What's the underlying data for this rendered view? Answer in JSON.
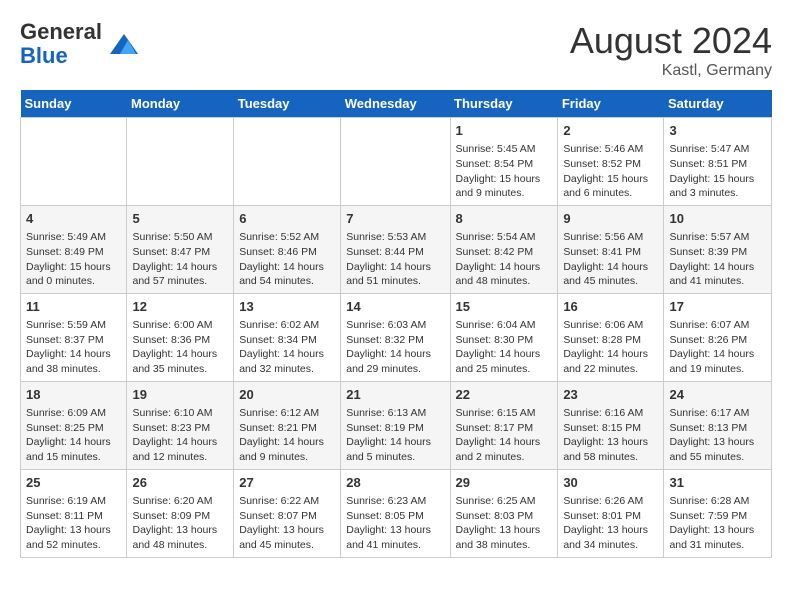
{
  "header": {
    "logo_general": "General",
    "logo_blue": "Blue",
    "month_year": "August 2024",
    "location": "Kastl, Germany"
  },
  "days_of_week": [
    "Sunday",
    "Monday",
    "Tuesday",
    "Wednesday",
    "Thursday",
    "Friday",
    "Saturday"
  ],
  "weeks": [
    [
      {
        "day": "",
        "info": ""
      },
      {
        "day": "",
        "info": ""
      },
      {
        "day": "",
        "info": ""
      },
      {
        "day": "",
        "info": ""
      },
      {
        "day": "1",
        "info": "Sunrise: 5:45 AM\nSunset: 8:54 PM\nDaylight: 15 hours\nand 9 minutes."
      },
      {
        "day": "2",
        "info": "Sunrise: 5:46 AM\nSunset: 8:52 PM\nDaylight: 15 hours\nand 6 minutes."
      },
      {
        "day": "3",
        "info": "Sunrise: 5:47 AM\nSunset: 8:51 PM\nDaylight: 15 hours\nand 3 minutes."
      }
    ],
    [
      {
        "day": "4",
        "info": "Sunrise: 5:49 AM\nSunset: 8:49 PM\nDaylight: 15 hours\nand 0 minutes."
      },
      {
        "day": "5",
        "info": "Sunrise: 5:50 AM\nSunset: 8:47 PM\nDaylight: 14 hours\nand 57 minutes."
      },
      {
        "day": "6",
        "info": "Sunrise: 5:52 AM\nSunset: 8:46 PM\nDaylight: 14 hours\nand 54 minutes."
      },
      {
        "day": "7",
        "info": "Sunrise: 5:53 AM\nSunset: 8:44 PM\nDaylight: 14 hours\nand 51 minutes."
      },
      {
        "day": "8",
        "info": "Sunrise: 5:54 AM\nSunset: 8:42 PM\nDaylight: 14 hours\nand 48 minutes."
      },
      {
        "day": "9",
        "info": "Sunrise: 5:56 AM\nSunset: 8:41 PM\nDaylight: 14 hours\nand 45 minutes."
      },
      {
        "day": "10",
        "info": "Sunrise: 5:57 AM\nSunset: 8:39 PM\nDaylight: 14 hours\nand 41 minutes."
      }
    ],
    [
      {
        "day": "11",
        "info": "Sunrise: 5:59 AM\nSunset: 8:37 PM\nDaylight: 14 hours\nand 38 minutes."
      },
      {
        "day": "12",
        "info": "Sunrise: 6:00 AM\nSunset: 8:36 PM\nDaylight: 14 hours\nand 35 minutes."
      },
      {
        "day": "13",
        "info": "Sunrise: 6:02 AM\nSunset: 8:34 PM\nDaylight: 14 hours\nand 32 minutes."
      },
      {
        "day": "14",
        "info": "Sunrise: 6:03 AM\nSunset: 8:32 PM\nDaylight: 14 hours\nand 29 minutes."
      },
      {
        "day": "15",
        "info": "Sunrise: 6:04 AM\nSunset: 8:30 PM\nDaylight: 14 hours\nand 25 minutes."
      },
      {
        "day": "16",
        "info": "Sunrise: 6:06 AM\nSunset: 8:28 PM\nDaylight: 14 hours\nand 22 minutes."
      },
      {
        "day": "17",
        "info": "Sunrise: 6:07 AM\nSunset: 8:26 PM\nDaylight: 14 hours\nand 19 minutes."
      }
    ],
    [
      {
        "day": "18",
        "info": "Sunrise: 6:09 AM\nSunset: 8:25 PM\nDaylight: 14 hours\nand 15 minutes."
      },
      {
        "day": "19",
        "info": "Sunrise: 6:10 AM\nSunset: 8:23 PM\nDaylight: 14 hours\nand 12 minutes."
      },
      {
        "day": "20",
        "info": "Sunrise: 6:12 AM\nSunset: 8:21 PM\nDaylight: 14 hours\nand 9 minutes."
      },
      {
        "day": "21",
        "info": "Sunrise: 6:13 AM\nSunset: 8:19 PM\nDaylight: 14 hours\nand 5 minutes."
      },
      {
        "day": "22",
        "info": "Sunrise: 6:15 AM\nSunset: 8:17 PM\nDaylight: 14 hours\nand 2 minutes."
      },
      {
        "day": "23",
        "info": "Sunrise: 6:16 AM\nSunset: 8:15 PM\nDaylight: 13 hours\nand 58 minutes."
      },
      {
        "day": "24",
        "info": "Sunrise: 6:17 AM\nSunset: 8:13 PM\nDaylight: 13 hours\nand 55 minutes."
      }
    ],
    [
      {
        "day": "25",
        "info": "Sunrise: 6:19 AM\nSunset: 8:11 PM\nDaylight: 13 hours\nand 52 minutes."
      },
      {
        "day": "26",
        "info": "Sunrise: 6:20 AM\nSunset: 8:09 PM\nDaylight: 13 hours\nand 48 minutes."
      },
      {
        "day": "27",
        "info": "Sunrise: 6:22 AM\nSunset: 8:07 PM\nDaylight: 13 hours\nand 45 minutes."
      },
      {
        "day": "28",
        "info": "Sunrise: 6:23 AM\nSunset: 8:05 PM\nDaylight: 13 hours\nand 41 minutes."
      },
      {
        "day": "29",
        "info": "Sunrise: 6:25 AM\nSunset: 8:03 PM\nDaylight: 13 hours\nand 38 minutes."
      },
      {
        "day": "30",
        "info": "Sunrise: 6:26 AM\nSunset: 8:01 PM\nDaylight: 13 hours\nand 34 minutes."
      },
      {
        "day": "31",
        "info": "Sunrise: 6:28 AM\nSunset: 7:59 PM\nDaylight: 13 hours\nand 31 minutes."
      }
    ]
  ]
}
